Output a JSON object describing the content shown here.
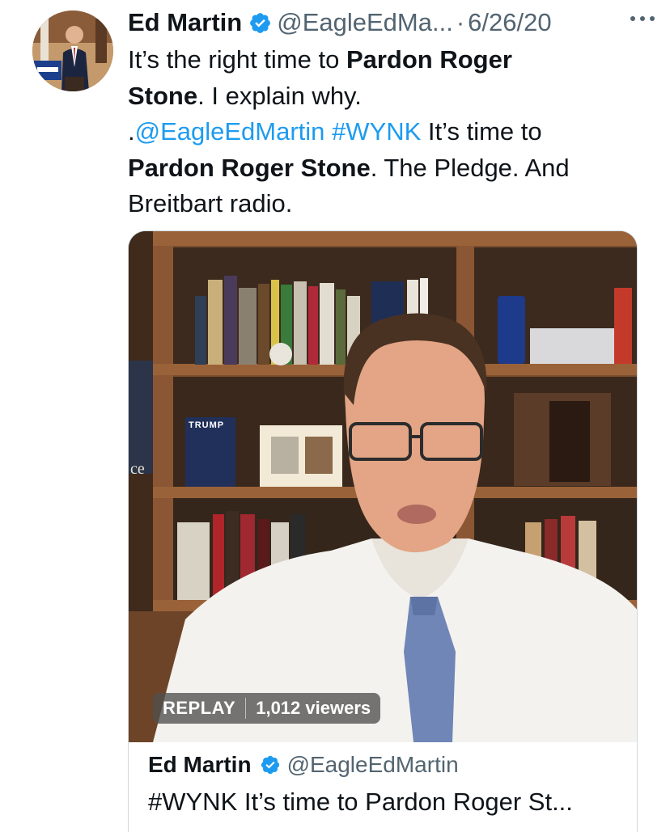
{
  "tweet": {
    "author_name": "Ed Martin",
    "author_handle": "@EagleEdMa...",
    "separator": "·",
    "date": "6/26/20",
    "text_line1_plain": "It’s the right time to ",
    "text_line1_bold": "Pardon Roger",
    "text_line2_bold": "Stone",
    "text_line2_plain": ". I explain why.",
    "text_line3_prefix": ".",
    "text_line3_mention": "@EagleEdMartin",
    "text_line3_space": " ",
    "text_line3_hashtag": "#WYNK",
    "text_line3_plain": " It’s time to",
    "text_line4_bold": "Pardon Roger Stone",
    "text_line4_plain": ". The Pledge. And",
    "text_line5_plain": "Breitbart radio."
  },
  "media": {
    "book_label": "TRUMP",
    "shelf_fragment": "ce",
    "replay_label": "REPLAY",
    "viewers_label": "1,012 viewers"
  },
  "card": {
    "author_name": "Ed Martin",
    "author_handle": "@EagleEdMartin",
    "title": "#WYNK It’s time to Pardon Roger St..."
  },
  "colors": {
    "link": "#1d9bf0",
    "verified": "#1d9bf0",
    "secondary_text": "#536471",
    "primary_text": "#0f1419"
  },
  "icons": {
    "verified": "verified-badge-icon",
    "more": "more-horizontal-icon"
  }
}
